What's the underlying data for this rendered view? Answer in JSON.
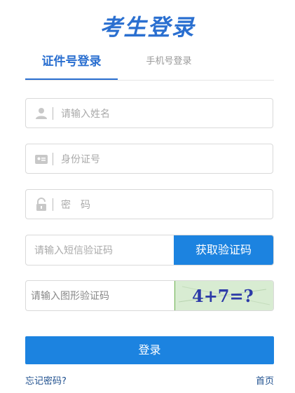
{
  "page": {
    "title": "考生登录"
  },
  "tabs": [
    {
      "label": "证件号登录",
      "active": true
    },
    {
      "label": "手机号登录",
      "active": false
    }
  ],
  "form": {
    "name_placeholder": "请输入姓名",
    "id_placeholder": "身份证号",
    "password_placeholder": "密　码",
    "sms_placeholder": "请输入短信验证码",
    "sms_button": "获取验证码",
    "captcha_placeholder": "请输入图形验证码",
    "captcha_text": "4+7=?"
  },
  "actions": {
    "login": "登录",
    "forgot": "忘记密码?",
    "home": "首页"
  },
  "colors": {
    "primary": "#1c83e0",
    "title": "#2a6fd0",
    "link": "#1e4f8e"
  }
}
